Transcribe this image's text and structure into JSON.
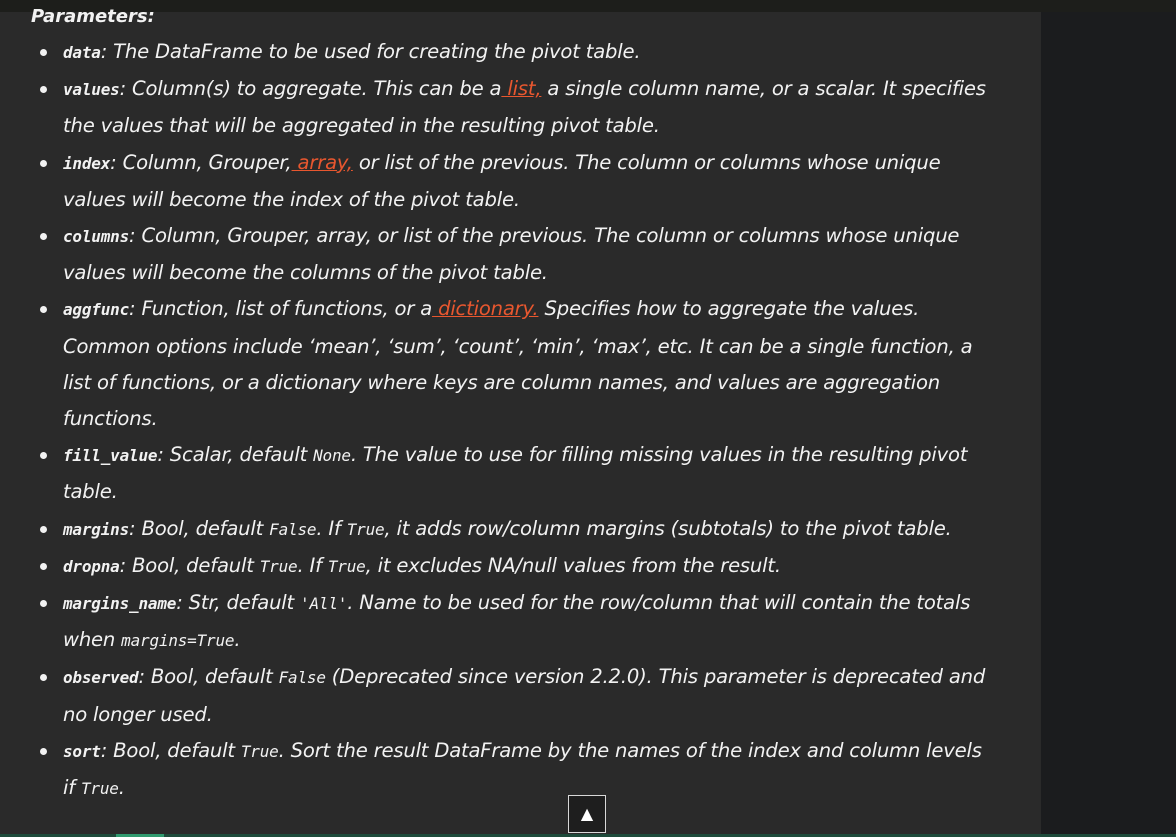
{
  "heading": "Parameters:",
  "scroll_top_glyph": "▲",
  "params": [
    {
      "name": "data",
      "text": ": The DataFrame to be used for creating the pivot table."
    },
    {
      "name": "values",
      "t1": ": Column(s) to aggregate. This can be a",
      "link": " list,",
      "t2": " a single column name, or a scalar. It specifies the values that will be aggregated in the resulting pivot table."
    },
    {
      "name": "index",
      "t1": ": Column, Grouper,",
      "link": " array,",
      "t2": " or list of the previous. The column or columns whose unique values will become the index of the pivot table."
    },
    {
      "name": "columns",
      "text": ": Column, Grouper, array, or list of the previous. The column or columns whose unique values will become the columns of the pivot table."
    },
    {
      "name": "aggfunc",
      "t1": ": Function, list of functions, or a",
      "link": " dictionary.",
      "t2": " Specifies how to aggregate the values. Common options include ‘mean’, ‘sum’, ‘count’, ‘min’, ‘max’, etc. It can be a single function, a list of functions, or a dictionary where keys are column names, and values are aggregation functions."
    },
    {
      "name": "fill_value",
      "t1": ": Scalar, default ",
      "c1": "None",
      "t2": ". The value to use for filling missing values in the resulting pivot table."
    },
    {
      "name": "margins",
      "t1": ": Bool, default ",
      "c1": "False",
      "t2": ". If ",
      "c2": "True",
      "t3": ", it adds row/column margins (subtotals) to the pivot table."
    },
    {
      "name": "dropna",
      "t1": ": Bool, default ",
      "c1": "True",
      "t2": ". If ",
      "c2": "True",
      "t3": ", it excludes NA/null values from the result."
    },
    {
      "name": "margins_name",
      "t1": ": Str, default ",
      "c1": "'All'",
      "t2": ". Name to be used for the row/column that will contain the totals when ",
      "c2": "margins=True",
      "t3": "."
    },
    {
      "name": "observed",
      "t1": ": Bool, default ",
      "c1": "False",
      "t2": " (Deprecated since version 2.2.0). This parameter is deprecated and no longer used."
    },
    {
      "name": "sort",
      "t1": ": Bool, default ",
      "c1": "True",
      "t2": ". Sort the result DataFrame by the names of the index and column levels if ",
      "c2": "True",
      "t3": "."
    }
  ]
}
